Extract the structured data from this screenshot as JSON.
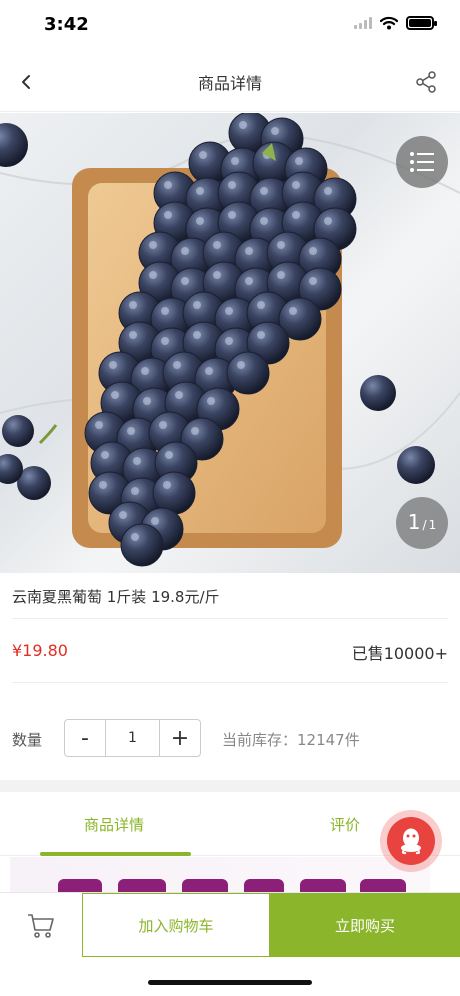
{
  "status_bar": {
    "time": "3:42"
  },
  "nav": {
    "title": "商品详情"
  },
  "gallery": {
    "current_page": "1",
    "separator": "/",
    "total_pages": "1"
  },
  "product": {
    "title": "云南夏黑葡萄 1斤装 19.8元/斤",
    "price": "¥19.80",
    "sold": "已售10000+"
  },
  "quantity": {
    "label": "数量",
    "minus": "-",
    "value": "1",
    "plus": "+",
    "stock": "当前库存：12147件"
  },
  "tabs": [
    {
      "label": "商品详情",
      "active": true
    },
    {
      "label": "评价",
      "active": false
    }
  ],
  "bottom_bar": {
    "add_to_cart": "加入购物车",
    "buy_now": "立即购买"
  },
  "colors": {
    "accent": "#8bb52a",
    "price": "#e02e24",
    "chat": "#e8433f",
    "grape": "#2d3550",
    "board": "#e0b57c"
  },
  "icons": [
    "back-icon",
    "share-icon",
    "list-menu-icon",
    "qq-chat-icon",
    "cart-icon",
    "wifi-icon",
    "battery-icon"
  ]
}
